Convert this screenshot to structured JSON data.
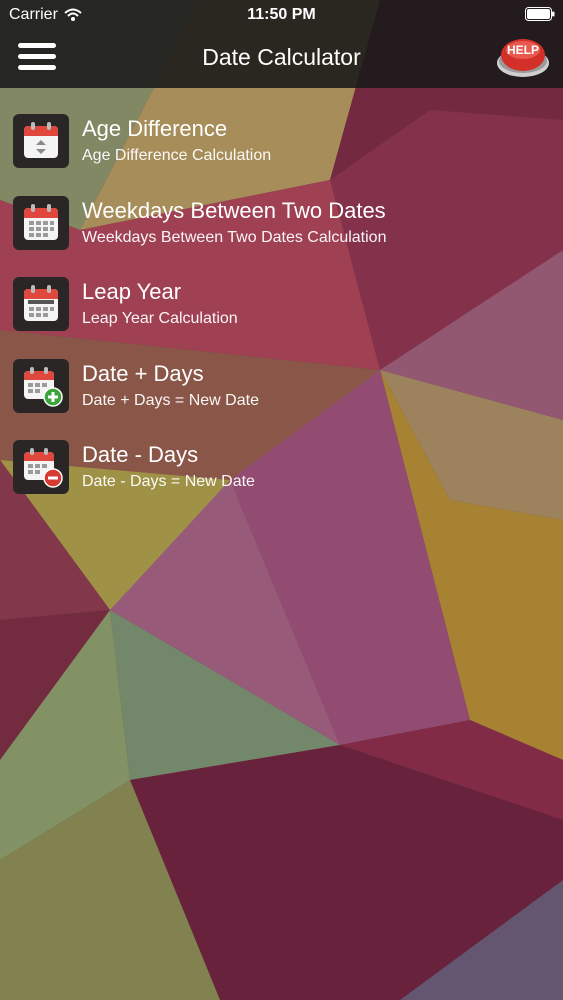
{
  "status": {
    "carrier": "Carrier",
    "time": "11:50 PM"
  },
  "header": {
    "title": "Date Calculator",
    "help_label": "HELP"
  },
  "items": [
    {
      "title": "Age Difference",
      "subtitle": "Age Difference Calculation",
      "icon": "calendar-updown-icon"
    },
    {
      "title": "Weekdays Between Two Dates",
      "subtitle": "Weekdays Between Two Dates Calculation",
      "icon": "calendar-grid-icon"
    },
    {
      "title": "Leap Year",
      "subtitle": "Leap Year Calculation",
      "icon": "calendar-feb-icon"
    },
    {
      "title": "Date + Days",
      "subtitle": "Date + Days = New Date",
      "icon": "calendar-plus-icon"
    },
    {
      "title": "Date - Days",
      "subtitle": "Date - Days = New Date",
      "icon": "calendar-minus-icon"
    }
  ],
  "colors": {
    "accent_red": "#e0473d",
    "plus_green": "#3aa63a",
    "minus_red": "#d63a30",
    "navbar": "#191919"
  }
}
